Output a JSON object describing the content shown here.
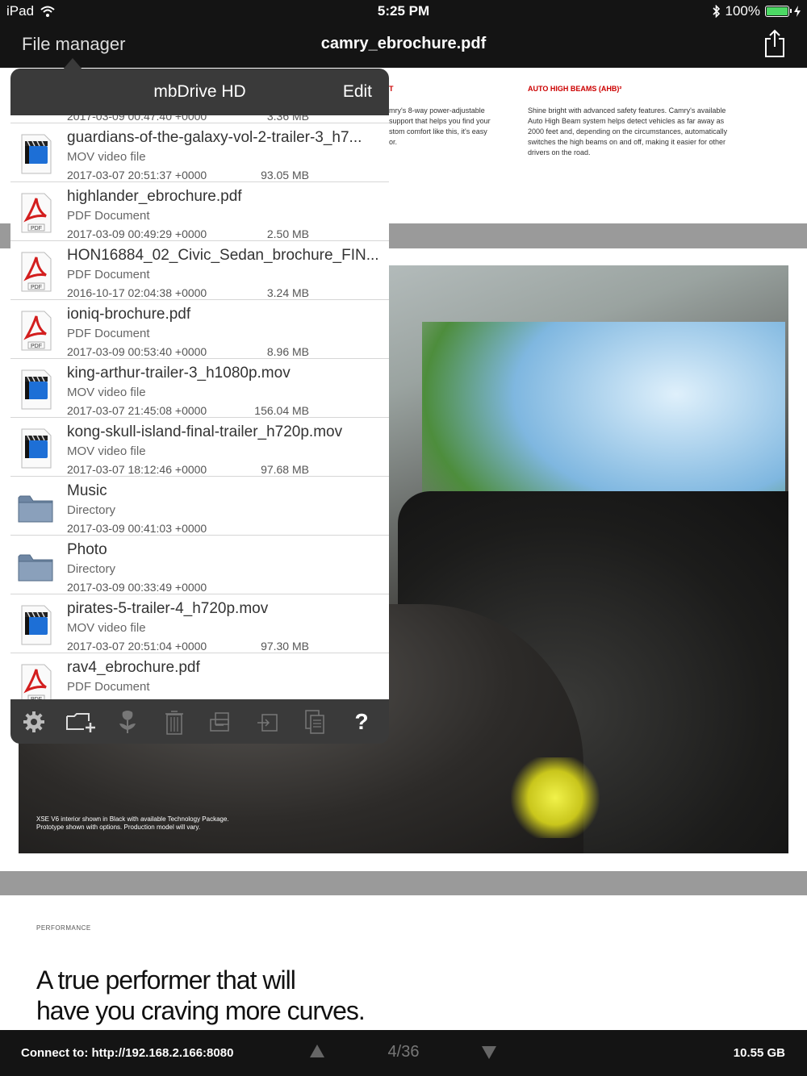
{
  "status": {
    "device": "iPad",
    "time": "5:25 PM",
    "battery": "100%",
    "battery_level": 1.0
  },
  "nav": {
    "back_label": "File manager",
    "title": "camry_ebrochure.pdf"
  },
  "pdf": {
    "top_left_heading": "T",
    "top_left_text": [
      "mry's 8-way power-adjustable",
      "support that helps you find your",
      "stom comfort like this, it's easy",
      "or."
    ],
    "top_right_heading": "AUTO HIGH BEAMS (AHB)²",
    "top_right_text": [
      "Shine bright with advanced safety features. Camry's available",
      "Auto High Beam system helps detect vehicles as far away as",
      "2000 feet and, depending on the circumstances, automatically",
      "switches the high beams on and off, making it easier for other",
      "drivers on the road."
    ],
    "photo_caption_1": "XSE V6 interior shown in Black with available Technology Package.",
    "photo_caption_2": "Prototype shown with options. Production model will vary.",
    "kicker": "PERFORMANCE",
    "headline_1": "A true performer that will",
    "headline_2": "have you craving more curves."
  },
  "popover": {
    "title": "mbDrive HD",
    "edit_label": "Edit",
    "partial_row": {
      "date": "2017-03-09 00:47:40 +0000",
      "size": "3.36 MB"
    },
    "rows": [
      {
        "name": "guardians-of-the-galaxy-vol-2-trailer-3_h7...",
        "kind": "MOV video file",
        "date": "2017-03-07 20:51:37 +0000",
        "size": "93.05 MB",
        "icon": "video-file-icon"
      },
      {
        "name": "highlander_ebrochure.pdf",
        "kind": "PDF Document",
        "date": "2017-03-09 00:49:29 +0000",
        "size": "2.50 MB",
        "icon": "pdf-file-icon"
      },
      {
        "name": "HON16884_02_Civic_Sedan_brochure_FIN...",
        "kind": "PDF Document",
        "date": "2016-10-17 02:04:38 +0000",
        "size": "3.24 MB",
        "icon": "pdf-file-icon"
      },
      {
        "name": "ioniq-brochure.pdf",
        "kind": "PDF Document",
        "date": "2017-03-09 00:53:40 +0000",
        "size": "8.96 MB",
        "icon": "pdf-file-icon"
      },
      {
        "name": "king-arthur-trailer-3_h1080p.mov",
        "kind": "MOV video file",
        "date": "2017-03-07 21:45:08 +0000",
        "size": "156.04 MB",
        "icon": "video-file-icon"
      },
      {
        "name": "kong-skull-island-final-trailer_h720p.mov",
        "kind": "MOV video file",
        "date": "2017-03-07 18:12:46 +0000",
        "size": "97.68 MB",
        "icon": "video-file-icon"
      },
      {
        "name": "Music",
        "kind": "Directory",
        "date": "2017-03-09 00:41:03 +0000",
        "size": "",
        "icon": "folder-icon"
      },
      {
        "name": "Photo",
        "kind": "Directory",
        "date": "2017-03-09 00:33:49 +0000",
        "size": "",
        "icon": "folder-icon"
      },
      {
        "name": "pirates-5-trailer-4_h720p.mov",
        "kind": "MOV video file",
        "date": "2017-03-07 20:51:04 +0000",
        "size": "97.30 MB",
        "icon": "video-file-icon"
      },
      {
        "name": "rav4_ebrochure.pdf",
        "kind": "PDF Document",
        "date": "",
        "size": "",
        "icon": "pdf-file-icon"
      }
    ],
    "toolbar": [
      "gear-icon",
      "new-folder-icon",
      "flower-icon",
      "trash-icon",
      "copy-icon",
      "move-icon",
      "paste-icon",
      "help-icon"
    ],
    "pdf_icon_label": "PDF",
    "help_label": "?"
  },
  "bottom": {
    "connect_label": "Connect to: http://192.168.2.166:8080",
    "page": "4/36",
    "storage": "10.55 GB"
  }
}
